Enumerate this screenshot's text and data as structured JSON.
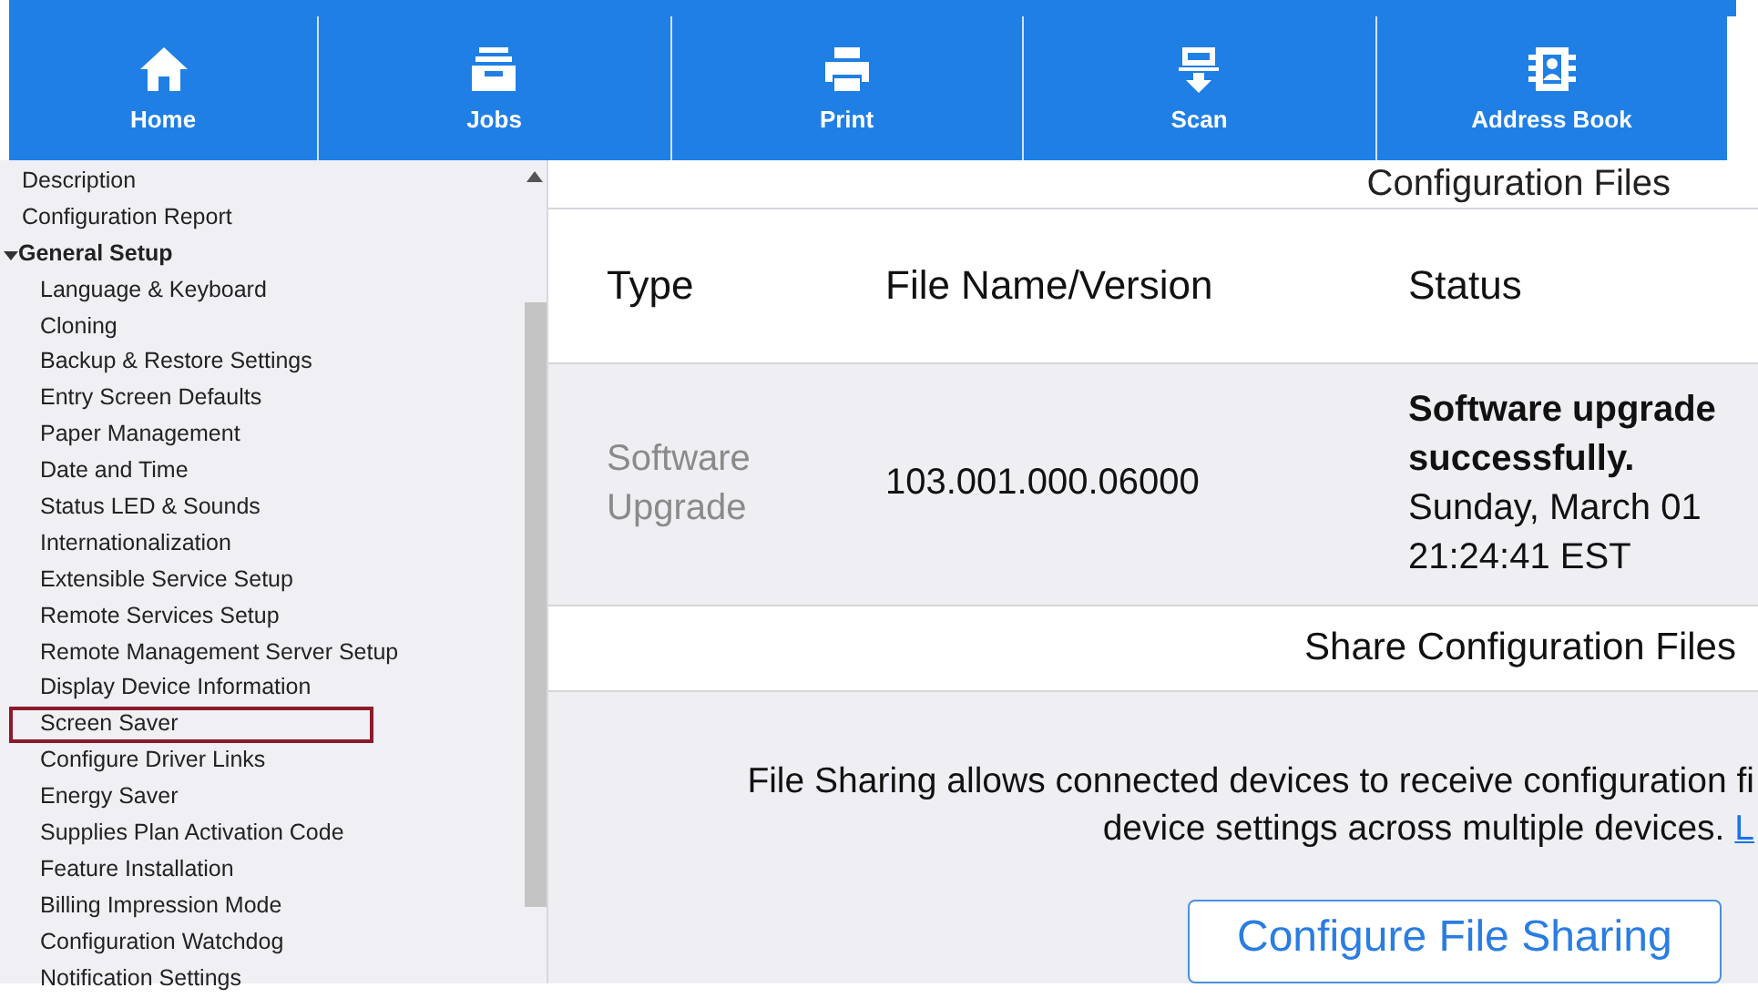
{
  "nav": [
    {
      "label": "Home",
      "kind": "home"
    },
    {
      "label": "Jobs",
      "kind": "jobs"
    },
    {
      "label": "Print",
      "kind": "print"
    },
    {
      "label": "Scan",
      "kind": "scan"
    },
    {
      "label": "Address Book",
      "kind": "address"
    }
  ],
  "sidebar": {
    "items": [
      {
        "label": "Description",
        "selected": false
      },
      {
        "label": "Configuration Report",
        "selected": false
      },
      {
        "label": "General Setup",
        "selected": false,
        "expanded": true,
        "children": [
          {
            "label": "Language & Keyboard",
            "selected": false
          },
          {
            "label": "Cloning",
            "selected": false
          },
          {
            "label": "Backup & Restore Settings",
            "selected": false
          },
          {
            "label": "Entry Screen Defaults",
            "selected": false
          },
          {
            "label": "Paper Management",
            "selected": false
          },
          {
            "label": "Date and Time",
            "selected": false
          },
          {
            "label": "Status LED & Sounds",
            "selected": false
          },
          {
            "label": "Internationalization",
            "selected": false
          },
          {
            "label": "Extensible Service Setup",
            "selected": false
          },
          {
            "label": "Remote Services Setup",
            "selected": false
          },
          {
            "label": "Remote Management Server Setup",
            "selected": false
          },
          {
            "label": "Display Device Information",
            "selected": false
          },
          {
            "label": "Screen Saver",
            "selected": true
          },
          {
            "label": "Configure Driver Links",
            "selected": false
          },
          {
            "label": "Energy Saver",
            "selected": false
          },
          {
            "label": "Supplies Plan Activation Code",
            "selected": false
          },
          {
            "label": "Feature Installation",
            "selected": false
          },
          {
            "label": "Billing Impression Mode",
            "selected": false
          },
          {
            "label": "Configuration Watchdog",
            "selected": false
          },
          {
            "label": "Notification Settings",
            "selected": false
          }
        ]
      }
    ]
  },
  "main": {
    "section_title": "Configuration Files",
    "table": {
      "columns": [
        "Type",
        "File Name/Version",
        "Status"
      ],
      "rows": [
        {
          "type": "Software Upgrade",
          "file": "103.001.000.06000",
          "status_title": "Software upgrade successfully.",
          "status_lines": [
            "Sunday, March 01",
            "21:24:41 EST"
          ]
        }
      ]
    },
    "share_title": "Share Configuration Files",
    "description_lines": [
      "File Sharing allows connected devices to receive configuration fi",
      "device settings across multiple devices."
    ],
    "link": "L",
    "button": "Configure File Sharing"
  }
}
